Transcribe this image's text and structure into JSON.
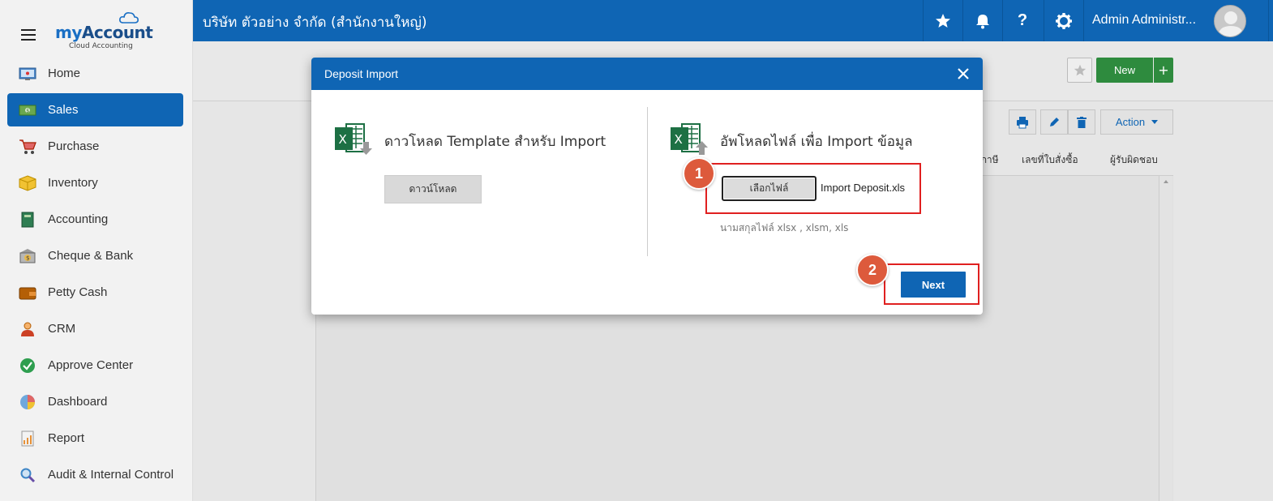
{
  "logo": {
    "brand_prefix": "my",
    "brand_suffix": "Account",
    "tagline": "Cloud Accounting"
  },
  "sidebar": {
    "items": [
      {
        "label": "Home",
        "icon": "home-icon",
        "active": false
      },
      {
        "label": "Sales",
        "icon": "sales-icon",
        "active": true
      },
      {
        "label": "Purchase",
        "icon": "cart-icon",
        "active": false
      },
      {
        "label": "Inventory",
        "icon": "box-icon",
        "active": false
      },
      {
        "label": "Accounting",
        "icon": "book-icon",
        "active": false
      },
      {
        "label": "Cheque & Bank",
        "icon": "bank-icon",
        "active": false
      },
      {
        "label": "Petty Cash",
        "icon": "wallet-icon",
        "active": false
      },
      {
        "label": "CRM",
        "icon": "people-icon",
        "active": false
      },
      {
        "label": "Approve Center",
        "icon": "check-circle-icon",
        "active": false
      },
      {
        "label": "Dashboard",
        "icon": "pie-chart-icon",
        "active": false
      },
      {
        "label": "Report",
        "icon": "report-icon",
        "active": false
      },
      {
        "label": "Audit & Internal Control",
        "icon": "magnifier-icon",
        "active": false
      }
    ]
  },
  "topbar": {
    "company": "บริษัท ตัวอย่าง จำกัด (สำนักงานใหญ่)",
    "user_name": "Admin Administr..."
  },
  "page": {
    "new_label": "New",
    "new_plus": "+",
    "action_label": "Action",
    "table_headers": [
      "ภาษี",
      "เลขที่ใบสั่งซื้อ",
      "ผู้รับผิดชอบ"
    ]
  },
  "modal": {
    "title": "Deposit Import",
    "download_section_title": "ดาวโหลด Template สำหรับ Import",
    "download_button": "ดาวน์โหลด",
    "upload_section_title": "อัพโหลดไฟล์ เพื่อ Import ข้อมูล",
    "choose_file_button": "เลือกไฟล์",
    "selected_file": "Import Deposit.xls",
    "extension_hint": "นามสกุลไฟล์ xlsx , xlsm, xls",
    "next_button": "Next"
  },
  "annotations": {
    "step1": "1",
    "step2": "2"
  },
  "colors": {
    "primary": "#0f65b4",
    "success": "#2e8b3e",
    "highlight": "#e02020",
    "badge": "#dd5a3c",
    "excel": "#1d7044"
  }
}
